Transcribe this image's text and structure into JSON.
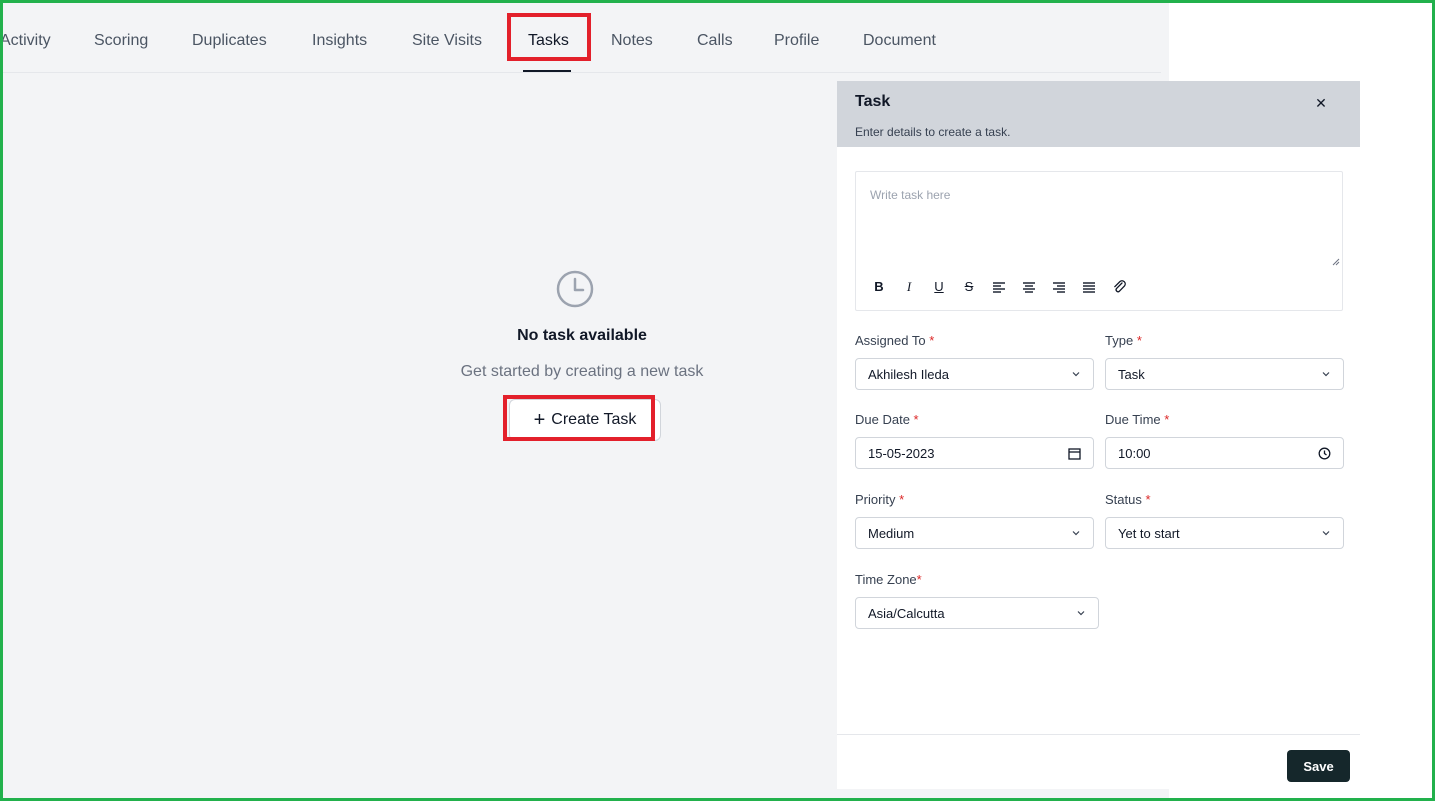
{
  "tabs": [
    {
      "label": "Activity"
    },
    {
      "label": "Scoring"
    },
    {
      "label": "Duplicates"
    },
    {
      "label": "Insights"
    },
    {
      "label": "Site Visits"
    },
    {
      "label": "Tasks",
      "active": true
    },
    {
      "label": "Notes"
    },
    {
      "label": "Calls"
    },
    {
      "label": "Profile"
    },
    {
      "label": "Document"
    }
  ],
  "empty_state": {
    "icon": "clock-icon",
    "title": "No task available",
    "subtitle": "Get started by creating a new task",
    "create_button": "Create Task",
    "create_icon": "plus-icon"
  },
  "task_panel": {
    "title": "Task",
    "subtitle": "Enter details to create a task.",
    "editor_placeholder": "Write task here",
    "toolbar": [
      "bold-icon",
      "italic-icon",
      "underline-icon",
      "strikethrough-icon",
      "align-left-icon",
      "align-center-icon",
      "align-right-icon",
      "align-justify-icon",
      "attach-icon"
    ],
    "fields": {
      "assigned_to": {
        "label": "Assigned To",
        "value": "Akhilesh Ileda"
      },
      "type": {
        "label": "Type",
        "value": "Task"
      },
      "due_date": {
        "label": "Due Date",
        "value": "15-05-2023"
      },
      "due_time": {
        "label": "Due Time",
        "value": "10:00"
      },
      "priority": {
        "label": "Priority",
        "value": "Medium"
      },
      "status": {
        "label": "Status",
        "value": "Yet to start"
      },
      "time_zone": {
        "label": "Time Zone",
        "value": "Asia/Calcutta"
      }
    },
    "required_mark": "*",
    "save_label": "Save"
  },
  "colors": {
    "highlight": "#e3202b",
    "frame": "#22b14c",
    "panel_header": "#d1d5db",
    "save_button": "#15272b",
    "required": "#dc2626"
  }
}
